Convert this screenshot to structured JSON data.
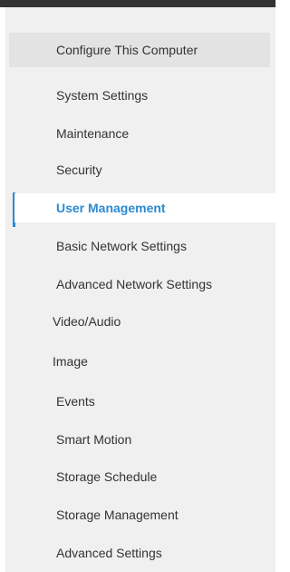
{
  "sidebar": {
    "header": "Configure This Computer",
    "items": [
      {
        "label": "System Settings"
      },
      {
        "label": "Maintenance"
      },
      {
        "label": "Security"
      },
      {
        "label": "User Management"
      },
      {
        "label": "Basic Network Settings"
      },
      {
        "label": "Advanced Network Settings"
      },
      {
        "label": "Video/Audio"
      },
      {
        "label": "Image"
      },
      {
        "label": "Events"
      },
      {
        "label": "Smart Motion"
      },
      {
        "label": "Storage Schedule"
      },
      {
        "label": "Storage Management"
      },
      {
        "label": "Advanced Settings"
      }
    ],
    "active_color": "#2b8ad0"
  }
}
